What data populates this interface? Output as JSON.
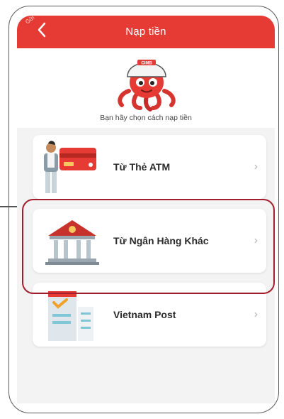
{
  "header": {
    "title": "Nạp tiền",
    "back_icon": "chevron-left-icon",
    "corner_badge": "Gửi"
  },
  "intro": {
    "subtitle": "Bạn hãy chọn cách nạp tiền",
    "mascot": "cimb-octopus-mascot"
  },
  "options": [
    {
      "label": "Từ Thẻ ATM",
      "icon": "atm-card-person-illustration"
    },
    {
      "label": "Từ Ngân Hàng Khác",
      "icon": "bank-building-illustration",
      "highlighted": true
    },
    {
      "label": "Vietnam Post",
      "icon": "post-office-illustration"
    }
  ],
  "colors": {
    "primary": "#e53b34",
    "highlight": "#a31f2d",
    "background": "#f3f3f3"
  }
}
